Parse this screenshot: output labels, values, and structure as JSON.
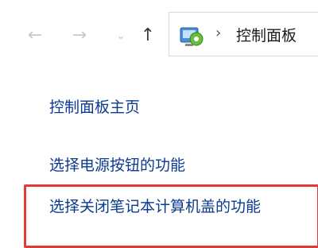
{
  "nav": {
    "back_icon": "←",
    "forward_icon": "→",
    "recent_icon": "⌄",
    "up_icon": "↑"
  },
  "address": {
    "icon": "control-panel-icon",
    "separator": "›",
    "location": "控制面板"
  },
  "sidebar": {
    "home_link": "控制面板主页",
    "power_button_link": "选择电源按钮的功能",
    "lid_link": "选择关闭笔记本计算机盖的功能"
  },
  "colors": {
    "link": "#0b3a8f",
    "highlight": "#e53935"
  }
}
